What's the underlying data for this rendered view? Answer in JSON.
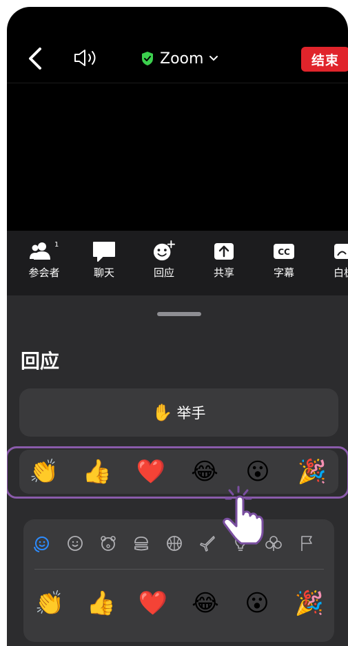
{
  "header": {
    "title": "Zoom",
    "end_label": "结束",
    "icons": [
      "back-icon",
      "speaker-icon",
      "shield-check-icon",
      "chevron-down-icon"
    ]
  },
  "toolbar": {
    "items": [
      {
        "label": "参会者",
        "icon": "participants-icon",
        "badge": "1"
      },
      {
        "label": "聊天",
        "icon": "chat-icon"
      },
      {
        "label": "回应",
        "icon": "reaction-icon"
      },
      {
        "label": "共享",
        "icon": "share-icon"
      },
      {
        "label": "字幕",
        "icon": "captions-icon",
        "icon_text": "CC"
      },
      {
        "label": "白板",
        "icon": "whiteboard-icon"
      }
    ]
  },
  "sheet": {
    "title": "回应",
    "raise_hand": {
      "emoji": "✋",
      "label": "举手"
    },
    "quick_reactions": [
      "👏",
      "👍",
      "❤️",
      "😂",
      "😮",
      "🎉"
    ],
    "picker_categories": [
      "smileys-icon",
      "smile-icon",
      "animals-icon",
      "food-icon",
      "sports-icon",
      "travel-icon",
      "objects-icon",
      "symbols-icon",
      "flags-icon"
    ],
    "picker_emojis": [
      "👏",
      "👍",
      "❤️",
      "😂",
      "😮",
      "🎉"
    ]
  },
  "colors": {
    "end_button": "#e0242b",
    "shield": "#3ccf4e",
    "highlight": "#8a5bab",
    "active_category": "#2d8cff"
  }
}
